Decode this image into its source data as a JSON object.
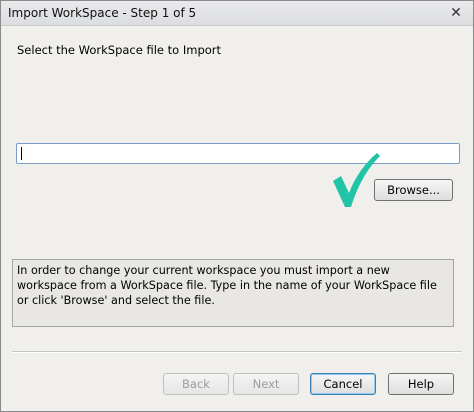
{
  "window": {
    "title": "Import WorkSpace - Step 1 of 5",
    "close_glyph": "✕"
  },
  "main": {
    "instruction": "Select the WorkSpace file to Import",
    "file_input": {
      "value": "",
      "placeholder": ""
    },
    "browse_label": "Browse...",
    "info_text": "In order to change your current workspace you must import a new workspace from a WorkSpace file. Type in the name of your WorkSpace file or click 'Browse' and select the file."
  },
  "footer": {
    "back_label": "Back",
    "next_label": "Next",
    "cancel_label": "Cancel",
    "help_label": "Help"
  },
  "colors": {
    "checkmark": "#22c4a8",
    "window_bg": "#f0efec",
    "input_border": "#7a9cc8"
  },
  "icons": {
    "close": "close-icon",
    "check": "checkmark-icon"
  }
}
